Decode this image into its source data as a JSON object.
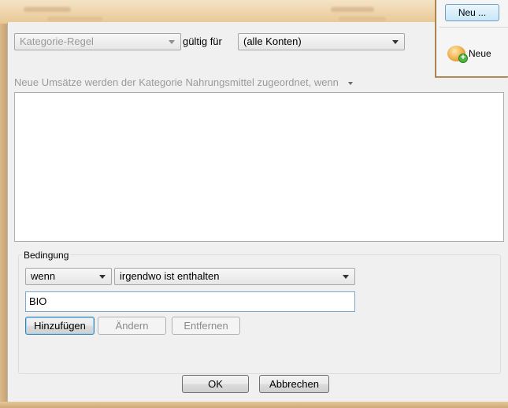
{
  "top": {
    "neu_button": "Neu ...",
    "neue_label": "Neue"
  },
  "rule_row": {
    "rule_type": "Kategorie-Regel",
    "valid_for_label": "gültig für",
    "account": "(alle Konten)"
  },
  "hint": "Neue Umsätze werden der Kategorie Nahrungsmittel zugeordnet, wenn",
  "condition": {
    "group_title": "Bedingung",
    "when": "wenn",
    "operator": "irgendwo ist enthalten",
    "value": "BIO",
    "add": "Hinzufügen",
    "change": "Ändern",
    "remove": "Entfernen"
  },
  "footer": {
    "ok": "OK",
    "cancel": "Abbrechen"
  }
}
